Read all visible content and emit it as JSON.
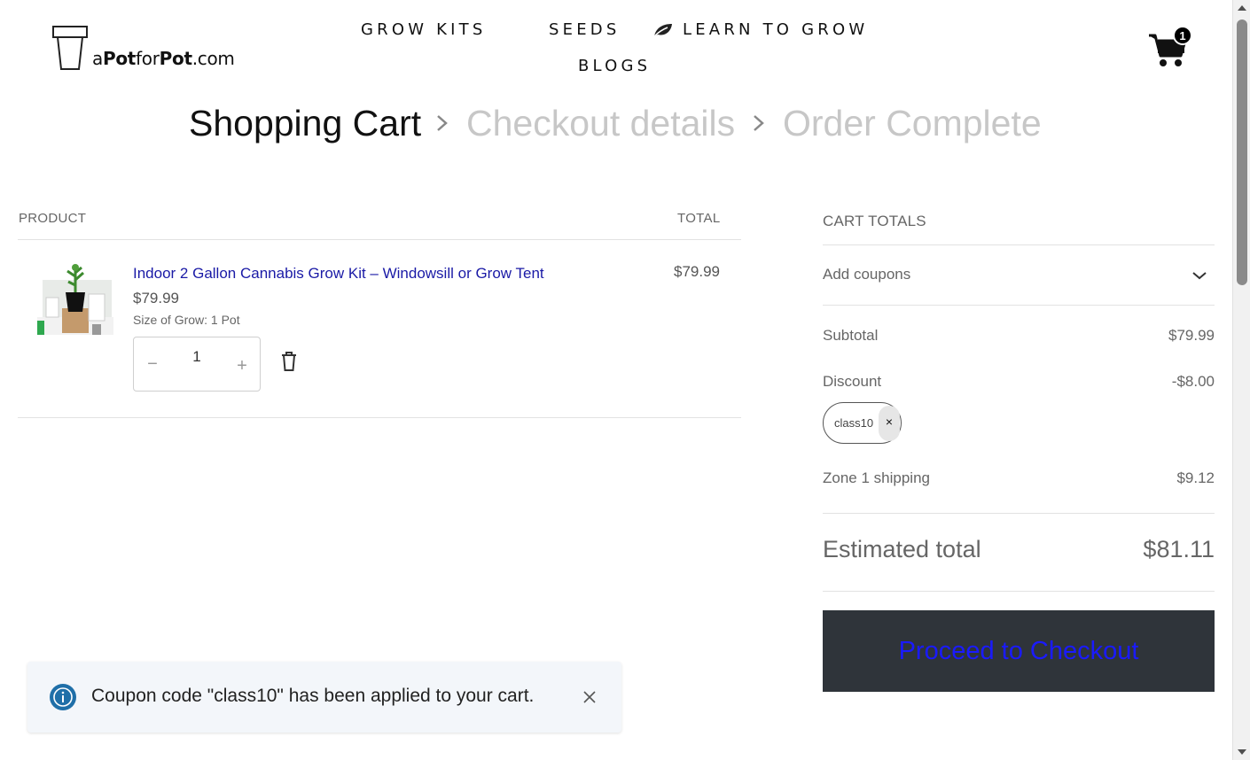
{
  "header": {
    "logo": {
      "prefix": "a",
      "bold1": "Pot",
      "middle": "for",
      "bold2": "Pot",
      "suffix": ".com"
    },
    "nav": {
      "grow_kits": "GROW KITS",
      "seeds": "SEEDS",
      "learn_to_grow": "LEARN TO GROW",
      "blogs": "BLOGS"
    },
    "cart_count": "1"
  },
  "breadcrumb": {
    "step1": "Shopping Cart",
    "step2": "Checkout details",
    "step3": "Order Complete",
    "active_color": "#111111",
    "inactive_color": "#c7c7c7"
  },
  "cart": {
    "col_product": "PRODUCT",
    "col_total": "TOTAL",
    "items": [
      {
        "name": "Indoor 2 Gallon Cannabis Grow Kit – Windowsill or Grow Tent",
        "price": "$79.99",
        "variant": "Size of Grow: 1 Pot",
        "quantity": "1",
        "total": "$79.99"
      }
    ]
  },
  "totals": {
    "title": "CART TOTALS",
    "add_coupons": "Add coupons",
    "subtotal_label": "Subtotal",
    "subtotal_value": "$79.99",
    "discount_label": "Discount",
    "discount_value": "-$8.00",
    "coupon_code": "class10",
    "coupon_remove": "×",
    "shipping_label": "Zone 1 shipping",
    "shipping_value": "$9.12",
    "estimated_label": "Estimated total",
    "estimated_value": "$81.11",
    "checkout_button": "Proceed to Checkout"
  },
  "notice": {
    "message": "Coupon code \"class10\" has been applied to your cart."
  },
  "colors": {
    "link": "#1a1aa6",
    "checkout_bg": "#2f343a",
    "checkout_text": "#1a1aff",
    "notice_bg": "#f3f6fa",
    "info_icon": "#1f6fa8"
  }
}
